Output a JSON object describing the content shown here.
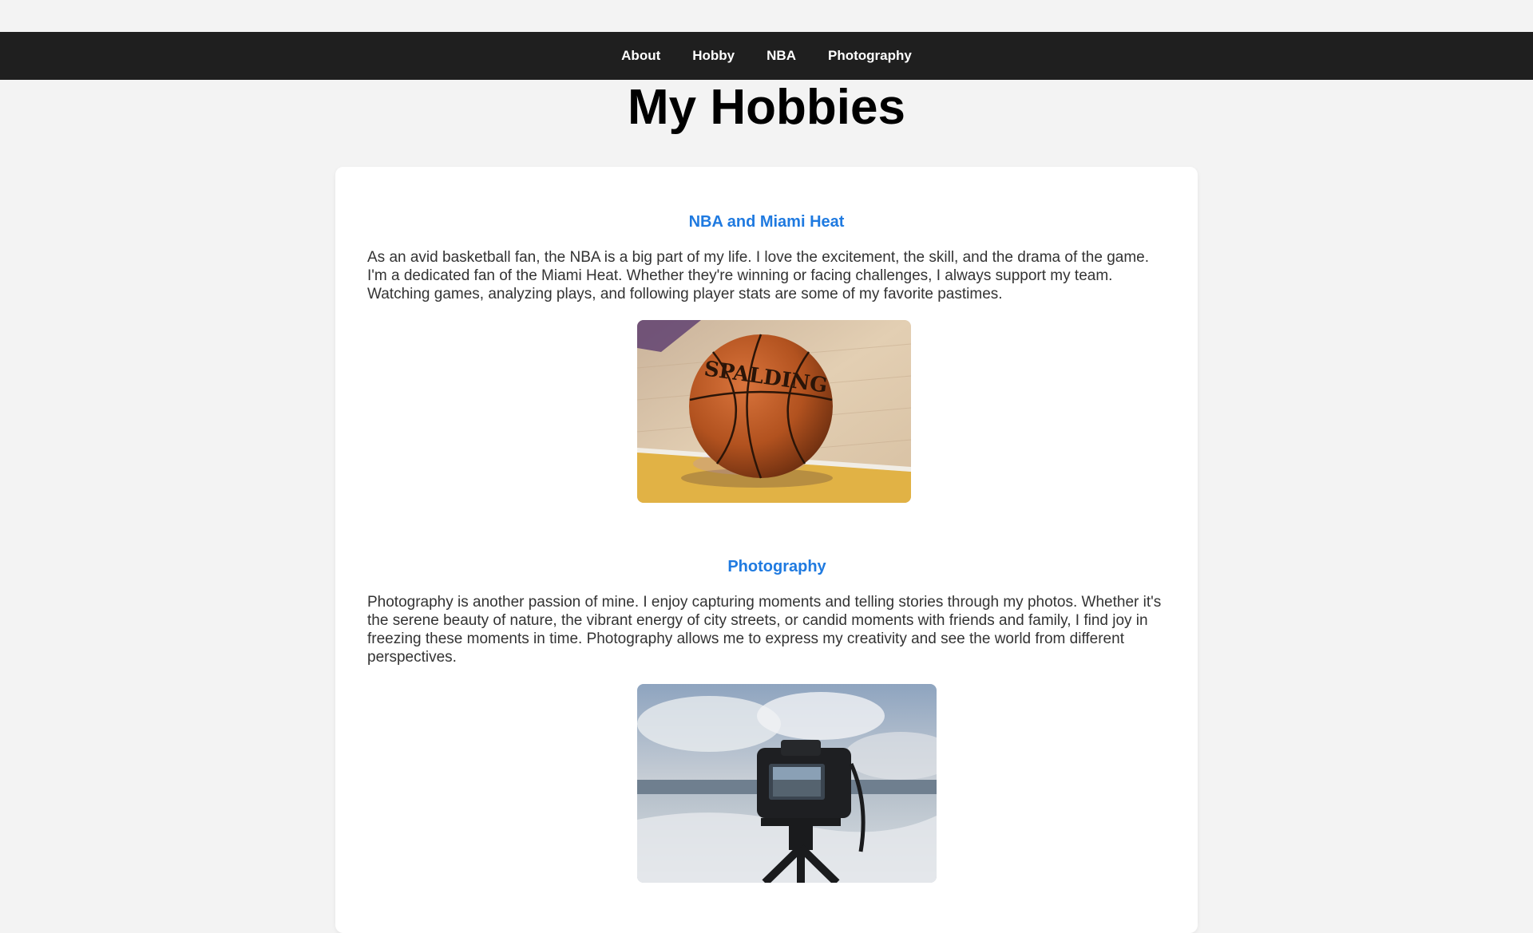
{
  "nav": {
    "items": [
      {
        "label": "About"
      },
      {
        "label": "Hobby"
      },
      {
        "label": "NBA"
      },
      {
        "label": "Photography"
      }
    ]
  },
  "page": {
    "title": "My Hobbies"
  },
  "sections": [
    {
      "title": "NBA and Miami Heat",
      "text": "As an avid basketball fan, the NBA is a big part of my life. I love the excitement, the skill, and the drama of the game. I'm a dedicated fan of the Miami Heat. Whether they're winning or facing challenges, I always support my team. Watching games, analyzing plays, and following player stats are some of my favorite pastimes.",
      "image_subject": "basketball on court",
      "ball_text": "SPALDING"
    },
    {
      "title": "Photography",
      "text": "Photography is another passion of mine. I enjoy capturing moments and telling stories through my photos. Whether it's the serene beauty of nature, the vibrant energy of city streets, or candid moments with friends and family, I find joy in freezing these moments in time. Photography allows me to express my creativity and see the world from different perspectives.",
      "image_subject": "camera on tripod at beach"
    }
  ],
  "colors": {
    "nav_bg": "#1f1f1f",
    "page_bg": "#f3f3f3",
    "section_title": "#1f7ae0"
  }
}
